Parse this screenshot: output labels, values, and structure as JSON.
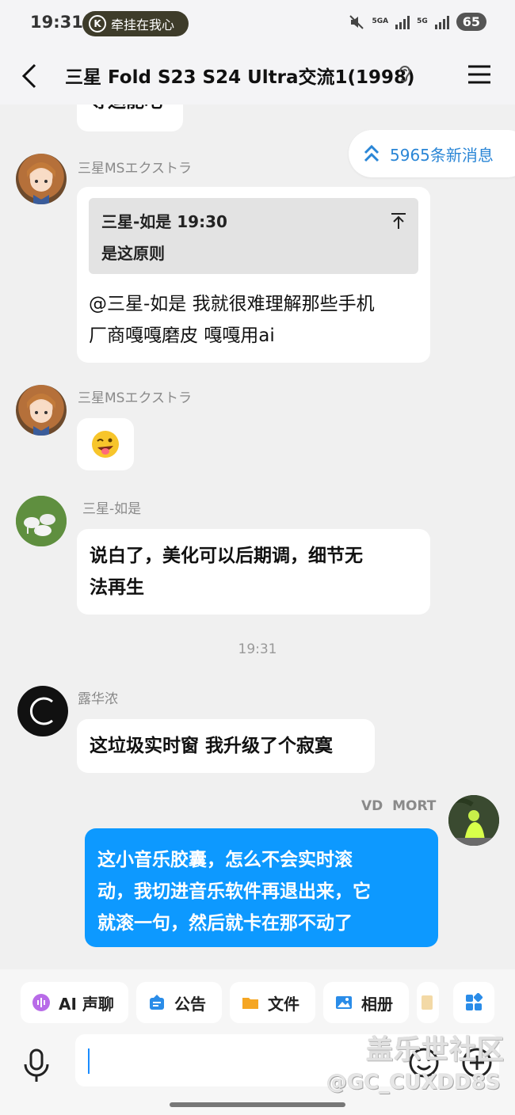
{
  "status_bar": {
    "time": "19:31",
    "pill_text": "牵挂在我心",
    "net1": "5GA",
    "net2": "5G",
    "battery": "65"
  },
  "header": {
    "title": "三星 Fold S23 S24 Ultra交流1(1998)"
  },
  "chat": {
    "top_partial_text": "等运能吧",
    "new_messages": "5965条新消息",
    "messages": [
      {
        "sender": "三星MSエクストラ",
        "quote_header": "三星-如是 19:30",
        "quote_text": "是这原则",
        "text_line1": "@三星-如是 我就很难理解那些手机",
        "text_line2": "厂商嘎嘎磨皮 嘎嘎用ai"
      },
      {
        "sender": "三星MSエクストラ",
        "emoji": "😜"
      },
      {
        "sender": "三星-如是",
        "text_line1": "说白了，美化可以后期调，细节无",
        "text_line2": "法再生"
      },
      {
        "timestamp": "19:31"
      },
      {
        "sender": "露华浓",
        "text_line1": "这垃圾实时窗 我升级了个寂寞"
      },
      {
        "sender": "VD  MORT",
        "text_line1": "这小音乐胶囊，怎么不会实时滚",
        "text_line2": "动，我切进音乐软件再退出来，它",
        "text_line3": "就滚一句，然后就卡在那不动了"
      }
    ]
  },
  "toolbar": {
    "chips": [
      "AI 声聊",
      "公告",
      "文件",
      "相册"
    ],
    "watermark_cn": "盖乐世社区",
    "watermark_id": "@GC_CUXDD8S"
  },
  "colors": {
    "accent": "#0d99ff",
    "link_blue": "#2a86d6",
    "background": "#f0f0f0"
  }
}
